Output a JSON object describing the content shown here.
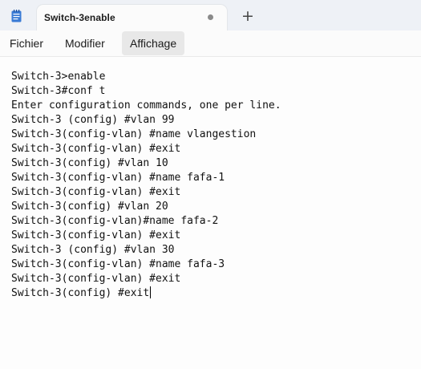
{
  "window": {
    "tab_title": "Switch-3enable",
    "tab_modified_indicator": "unsaved-dot",
    "new_tab_label": "+",
    "app_icon": "notepad-icon"
  },
  "menu": {
    "items": [
      "Fichier",
      "Modifier",
      "Affichage"
    ],
    "active": "Affichage"
  },
  "editor": {
    "lines": [
      "Switch-3>enable",
      "Switch-3#conf t",
      "Enter configuration commands, one per line.",
      "Switch-3 (config) #vlan 99",
      "Switch-3(config-vlan) #name vlangestion",
      "Switch-3(config-vlan) #exit",
      "Switch-3(config) #vlan 10",
      "Switch-3(config-vlan) #name fafa-1",
      "Switch-3(config-vlan) #exit",
      "Switch-3(config) #vlan 20",
      "Switch-3(config-vlan)#name fafa-2",
      "Switch-3(config-vlan) #exit",
      "Switch-3 (config) #vlan 30",
      "Switch-3(config-vlan) #name fafa-3",
      "Switch-3(config-vlan) #exit",
      "Switch-3(config) #exit"
    ]
  }
}
